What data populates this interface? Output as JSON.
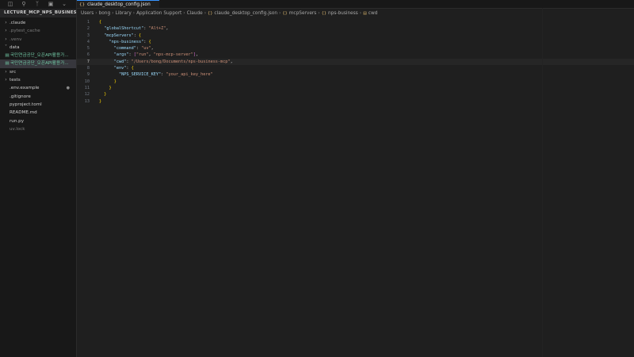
{
  "activity_icons": [
    "files-icon",
    "search-icon",
    "source-control-icon",
    "extensions-icon",
    "chevron-down-icon"
  ],
  "explorer": {
    "title": "LECTURE_MCP_NPS_BUSINESS...",
    "items": [
      {
        "label": ".claude",
        "kind": "folder",
        "expanded": false,
        "style": "normal"
      },
      {
        "label": ".pytest_cache",
        "kind": "folder",
        "expanded": false,
        "style": "dim"
      },
      {
        "label": ".venv",
        "kind": "folder",
        "expanded": false,
        "style": "dim"
      },
      {
        "label": "data",
        "kind": "folder",
        "expanded": true,
        "style": "normal"
      },
      {
        "label": "국민연금공단_오픈API활용가...",
        "kind": "file",
        "style": "green"
      },
      {
        "label": "국민연금공단_오픈API활용가...",
        "kind": "file",
        "style": "green"
      },
      {
        "label": "src",
        "kind": "folder",
        "expanded": false,
        "style": "normal"
      },
      {
        "label": "tests",
        "kind": "folder",
        "expanded": false,
        "style": "normal"
      },
      {
        "label": ".env.example",
        "kind": "file",
        "style": "normal",
        "dot": "●"
      },
      {
        "label": ".gitignore",
        "kind": "file",
        "style": "normal"
      },
      {
        "label": "pyproject.toml",
        "kind": "file",
        "style": "normal"
      },
      {
        "label": "README.md",
        "kind": "file",
        "style": "normal"
      },
      {
        "label": "run.py",
        "kind": "file",
        "style": "normal"
      },
      {
        "label": "uv.lock",
        "kind": "file",
        "style": "dim"
      }
    ]
  },
  "tab": {
    "label": "claude_desktop_config.json",
    "icon": "{}"
  },
  "breadcrumb": [
    "Users",
    "bong",
    "Library",
    "Application Support",
    "Claude",
    "claude_desktop_config.json",
    "mcpServers",
    "nps-business",
    "cwd"
  ],
  "editor": {
    "active_line": 7,
    "lines": [
      {
        "n": "1",
        "text": "{"
      },
      {
        "n": "2",
        "text": "  \"globalShortcut\": \"Alt+Z\","
      },
      {
        "n": "3",
        "text": "  \"mcpServers\": {"
      },
      {
        "n": "4",
        "text": "    \"nps-business\": {"
      },
      {
        "n": "5",
        "text": "      \"command\": \"uv\","
      },
      {
        "n": "6",
        "text": "      \"args\": [\"run\", \"nps-mcp-server\"],"
      },
      {
        "n": "7",
        "text": "      \"cwd\": \"/Users/bong/Documents/nps-business-mcp\","
      },
      {
        "n": "8",
        "text": "      \"env\": {"
      },
      {
        "n": "9",
        "text": "        \"NPS_SERVICE_KEY\": \"your_api_key_here\""
      },
      {
        "n": "10",
        "text": "      }"
      },
      {
        "n": "11",
        "text": "    }"
      },
      {
        "n": "12",
        "text": "  }"
      },
      {
        "n": "13",
        "text": "}"
      }
    ]
  },
  "colors": {
    "background": "#1f1f1f",
    "sidebar": "#181818",
    "key": "#9cdcfe",
    "string": "#ce9178",
    "accent": "#3794ff"
  }
}
